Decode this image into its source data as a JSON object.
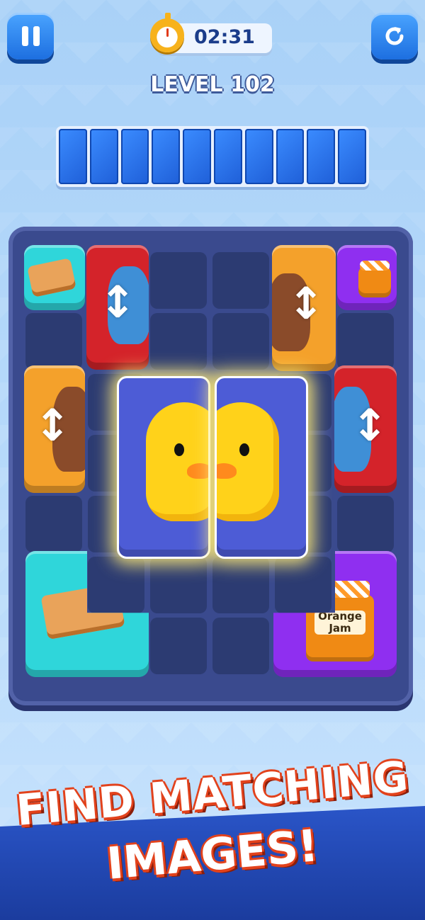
{
  "hud": {
    "timer": "02:31",
    "level_label": "LEVEL 102",
    "pause_icon": "pause-icon",
    "restart_icon": "restart-icon",
    "stopwatch_icon": "stopwatch-icon"
  },
  "collection_tray": {
    "slot_count": 10,
    "filled_slots": 0
  },
  "board": {
    "tiles": [
      {
        "id": "cookie-small",
        "color": "#2fd6da",
        "image": "cookie-sandwich-icon"
      },
      {
        "id": "shark-vertical",
        "color": "#d4232a",
        "image": "shark-icon",
        "movable": "vertical"
      },
      {
        "id": "turkey-vertical-top",
        "color": "#f4a12b",
        "image": "turkey-icon",
        "movable": "vertical"
      },
      {
        "id": "jam-small",
        "color": "#8f2ff0",
        "image": "orange-jam-icon"
      },
      {
        "id": "turkey-vertical-left",
        "color": "#f4a12b",
        "image": "turkey-icon",
        "movable": "vertical"
      },
      {
        "id": "shark-vertical-right",
        "color": "#d4232a",
        "image": "shark-icon",
        "movable": "vertical"
      },
      {
        "id": "duck-left-half",
        "color": "#4d5cd6",
        "image": "duck-icon",
        "highlighted": true
      },
      {
        "id": "duck-right-half",
        "color": "#4d5cd6",
        "image": "duck-icon",
        "highlighted": true
      },
      {
        "id": "cookie-large",
        "color": "#2fd6da",
        "image": "cookie-sandwich-icon"
      },
      {
        "id": "jam-large",
        "color": "#8f2ff0",
        "image": "orange-jam-icon",
        "label": "Orange Jam"
      }
    ]
  },
  "banner": {
    "line1": "FIND MATCHING",
    "line2": "IMAGES!"
  }
}
